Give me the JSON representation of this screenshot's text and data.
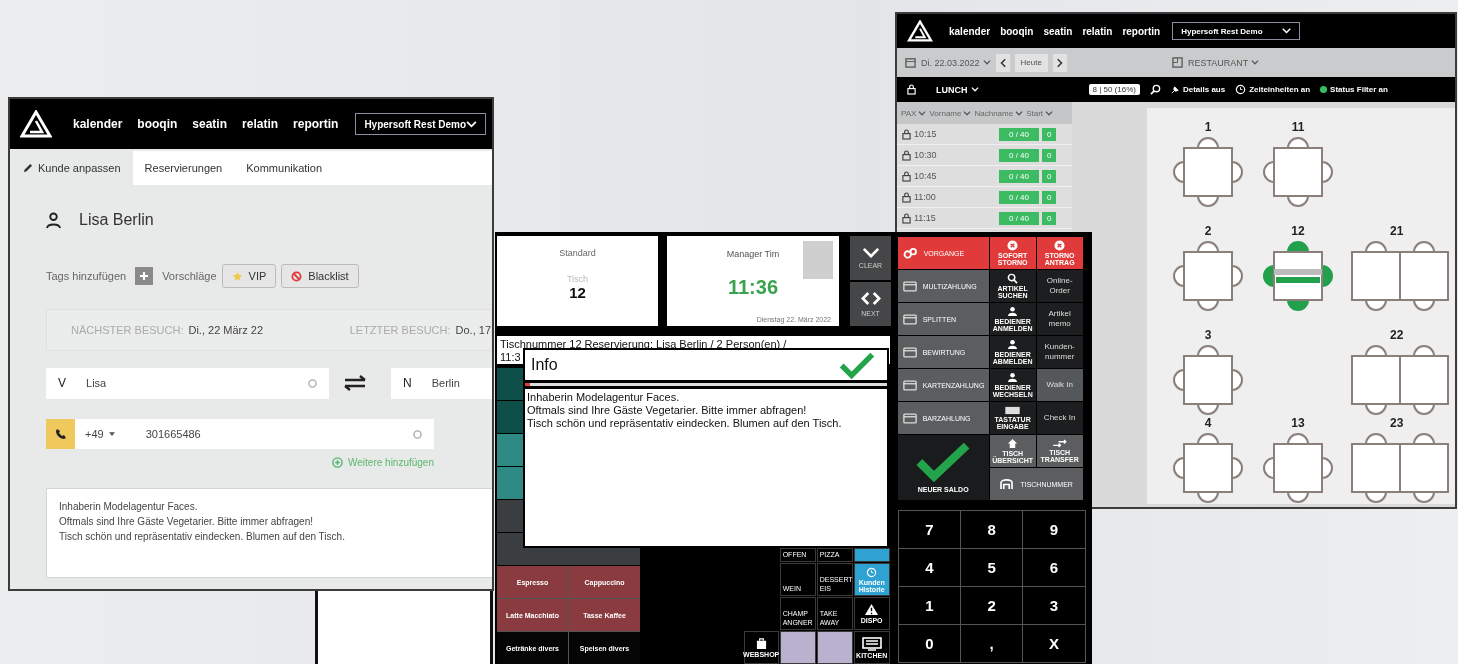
{
  "customer_window": {
    "nav": {
      "items": [
        "kalender",
        "booqin",
        "seatin",
        "relatin",
        "reportin"
      ],
      "venue": "Hypersoft Rest Demo"
    },
    "tabs": [
      {
        "label": "Kunde anpassen",
        "selected": true
      },
      {
        "label": "Reservierungen",
        "selected": false
      },
      {
        "label": "Kommunikation",
        "selected": false
      }
    ],
    "customer_name": "Lisa Berlin",
    "tags": {
      "add_label": "Tags hinzufügen",
      "suggestions_label": "Vorschläge",
      "chips": [
        {
          "kind": "star",
          "label": "VIP"
        },
        {
          "kind": "blocked",
          "label": "Blacklist"
        }
      ]
    },
    "visits": [
      {
        "label": "NÄCHSTER BESUCH:",
        "value": "Di., 22 März 22"
      },
      {
        "label": "LETZTER BESUCH:",
        "value": "Do., 17"
      }
    ],
    "first_name": {
      "prefix": "V",
      "value": "Lisa"
    },
    "last_name": {
      "prefix": "N",
      "value": "Berlin"
    },
    "phone": {
      "country_code": "+49",
      "value": "301665486"
    },
    "add_more": "Weitere hinzufügen",
    "notes": [
      "Inhaberin Modelagentur Faces.",
      "Oftmals sind Ihre Gäste Vegetarier. Bitte immer abfragen!",
      "Tisch schön und repräsentativ eindecken. Blumen auf den Tisch."
    ]
  },
  "seating_window": {
    "nav": {
      "items": [
        "kalender",
        "booqin",
        "seatin",
        "relatin",
        "reportin"
      ],
      "venue": "Hypersoft Rest Demo"
    },
    "date": "Di. 22.03.2022",
    "today": "Heute",
    "area": "RESTAURANT",
    "shift": "LUNCH",
    "occupancy": "8 | 50 (16%)",
    "toggles": [
      "Details aus",
      "Zeiteinheiten an",
      "Status Filter an"
    ],
    "columns": [
      "PAX",
      "Vorname",
      "Nachname",
      "Start"
    ],
    "slots": [
      {
        "time": "10:15",
        "capacity": "0 / 40",
        "count": "0"
      },
      {
        "time": "10:30",
        "capacity": "0 / 40",
        "count": "0"
      },
      {
        "time": "10:45",
        "capacity": "0 / 40",
        "count": "0"
      },
      {
        "time": "11:00",
        "capacity": "0 / 40",
        "count": "0"
      },
      {
        "time": "11:15",
        "capacity": "0 / 40",
        "count": "0"
      }
    ],
    "floor": [
      [
        {
          "kind": "single",
          "number": "1",
          "occupied": false
        },
        {
          "kind": "single",
          "number": "11",
          "occupied": false
        },
        {
          "kind": "empty"
        }
      ],
      [
        {
          "kind": "single",
          "number": "2",
          "occupied": false
        },
        {
          "kind": "single",
          "number": "12",
          "occupied": true
        },
        {
          "kind": "double",
          "number": "21",
          "occupied": false
        }
      ],
      [
        {
          "kind": "single",
          "number": "3",
          "occupied": false
        },
        {
          "kind": "empty"
        },
        {
          "kind": "double",
          "number": "22",
          "occupied": false
        }
      ],
      [
        {
          "kind": "single",
          "number": "4",
          "occupied": false
        },
        {
          "kind": "single",
          "number": "13",
          "occupied": false
        },
        {
          "kind": "double",
          "number": "23",
          "occupied": false
        }
      ]
    ]
  },
  "pos": {
    "order_type": "Standard",
    "table_label": "Tisch",
    "table_number": "12",
    "waiter": "Manager Tim",
    "time": "11:36",
    "date": "Dienstag 22. März 2022",
    "side_buttons": [
      {
        "kind": "down",
        "label": "CLEAR"
      },
      {
        "kind": "swap",
        "label": "NEXT"
      }
    ],
    "order_line": "Tischnummer 12 Reservierung: Lisa Berlin / 2 Person(en) /",
    "order_line_2": "11:3",
    "info_dialog": {
      "title": "Info",
      "lines": [
        "Inhaberin Modelagentur Faces.",
        "Oftmals sind Ihre Gäste Vegetarier. Bitte immer abfragen!",
        "Tisch schön und repräsentativ eindecken. Blumen auf den Tisch."
      ]
    },
    "covered_tiles": [
      {
        "color": "#0e4f4a"
      },
      {
        "color": "#0e4f4a"
      },
      {
        "color": "#2e8a83"
      },
      {
        "color": "#2e8a83"
      },
      {
        "color": "#3b3e40"
      },
      {
        "color": "#3b3e40"
      }
    ],
    "products": [
      {
        "label": "Espresso",
        "color": "#8a3b3f"
      },
      {
        "label": "Cappuccino",
        "color": "#8a3b3f"
      },
      {
        "label": "Latte Macchiato",
        "color": "#8a3b3f"
      },
      {
        "label": "Tasse Kaffee",
        "color": "#8a3b3f"
      },
      {
        "label": "Getränke divers",
        "color": "#050505"
      },
      {
        "label": "Speisen divers",
        "color": "#050505"
      }
    ],
    "categories": [
      {
        "kind": "blank"
      },
      {
        "kind": "label",
        "label": "OFFEN"
      },
      {
        "kind": "label",
        "label": "PIZZA"
      },
      {
        "kind": "blue"
      },
      {
        "kind": "blank"
      },
      {
        "kind": "label",
        "label": "WEIN"
      },
      {
        "kind": "label",
        "label": "DESSERT EIS"
      },
      {
        "kind": "history",
        "label": "Kunden Historie"
      },
      {
        "kind": "blank"
      },
      {
        "kind": "label",
        "label": "CHAMP ANGNER"
      },
      {
        "kind": "label",
        "label": "TAKE AWAY"
      },
      {
        "kind": "alert",
        "label": "DISPO"
      },
      {
        "kind": "shop",
        "label": "WEBSHOP"
      },
      {
        "kind": "lilac"
      },
      {
        "kind": "lilac"
      },
      {
        "kind": "kitchen",
        "label": "KITCHEN"
      }
    ],
    "functions": [
      [
        {
          "kind": "primary",
          "label": "VORGANGE"
        },
        {
          "kind": "danger",
          "label": "SOFORT STORNO"
        },
        {
          "kind": "danger",
          "label": "STORNO ANTRAG"
        }
      ],
      [
        {
          "kind": "action",
          "label": "MULTIZAHLUNG"
        },
        {
          "kind": "tool",
          "label": "ARTIKEL SUCHEN"
        },
        {
          "kind": "dark",
          "label": "Online-Order"
        }
      ],
      [
        {
          "kind": "action",
          "label": "SPLITTEN"
        },
        {
          "kind": "tool",
          "label": "BEDIENER ANMELDEN"
        },
        {
          "kind": "dark",
          "label": "Artikel memo"
        }
      ],
      [
        {
          "kind": "action",
          "label": "BEWIRTUNG"
        },
        {
          "kind": "tool",
          "label": "BEDIENER ABMELDEN"
        },
        {
          "kind": "dark",
          "label": "Kunden-nummer"
        }
      ],
      [
        {
          "kind": "action",
          "label": "KARTENZAHLUNG"
        },
        {
          "kind": "tool",
          "label": "BEDIENER WECHSELN"
        },
        {
          "kind": "grey",
          "label": "Walk In"
        }
      ],
      [
        {
          "kind": "action",
          "label": "BARZAHLUNG"
        },
        {
          "kind": "tool",
          "label": "TASTATUR EINGABE"
        },
        {
          "kind": "dark",
          "label": "Check In"
        }
      ]
    ],
    "confirm": "NEUER SALDO",
    "table_actions": [
      "TISCH ÜBERSICHT",
      "TISCH TRANSFER"
    ],
    "table_number_button": "TISCHNUMMER",
    "keypad": [
      "7",
      "8",
      "9",
      "4",
      "5",
      "6",
      "1",
      "2",
      "3",
      "0",
      ",",
      "X"
    ]
  }
}
